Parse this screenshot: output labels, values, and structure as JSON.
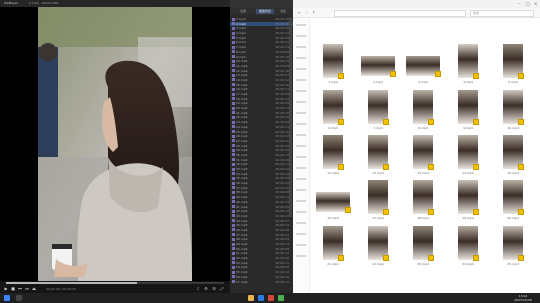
{
  "player": {
    "app_name": "PotPlayer",
    "file_name": "2.mp4 · 1920x1080",
    "time_label": "00:00:18 / 00:00:30"
  },
  "playlist": {
    "header": "播放列表",
    "tabs": [
      "全部",
      "播放列表",
      "书签"
    ],
    "items": [
      {
        "name": "1.mp4",
        "duration": "00:00:30"
      },
      {
        "name": "2.mp4",
        "duration": "00:00:30"
      },
      {
        "name": "3.mp4",
        "duration": "00:00:15"
      },
      {
        "name": "4.mp4",
        "duration": "00:00:12"
      },
      {
        "name": "5.mp4",
        "duration": "00:00:09"
      },
      {
        "name": "6.mp4",
        "duration": "00:00:11"
      },
      {
        "name": "7.mp4",
        "duration": "00:00:14"
      },
      {
        "name": "8.mp4",
        "duration": "00:00:08"
      },
      {
        "name": "9.mp4",
        "duration": "00:00:10"
      },
      {
        "name": "10.mp4",
        "duration": "00:00:13"
      },
      {
        "name": "11.mp4",
        "duration": "00:00:09"
      },
      {
        "name": "12.mp4",
        "duration": "00:00:16"
      },
      {
        "name": "13.mp4",
        "duration": "00:00:07"
      },
      {
        "name": "14.mp4",
        "duration": "00:00:12"
      },
      {
        "name": "15.mp4",
        "duration": "00:00:10"
      },
      {
        "name": "16.mp4",
        "duration": "00:00:11"
      },
      {
        "name": "17.mp4",
        "duration": "00:00:09"
      },
      {
        "name": "18.mp4",
        "duration": "00:00:14"
      },
      {
        "name": "19.mp4",
        "duration": "00:00:08"
      },
      {
        "name": "20.mp4",
        "duration": "00:00:13"
      },
      {
        "name": "21.mp4",
        "duration": "00:00:10"
      },
      {
        "name": "22.mp4",
        "duration": "00:00:12"
      },
      {
        "name": "23.mp4",
        "duration": "00:00:09"
      },
      {
        "name": "24.mp4",
        "duration": "00:00:11"
      },
      {
        "name": "25.mp4",
        "duration": "00:00:15"
      },
      {
        "name": "26.mp4",
        "duration": "00:00:07"
      },
      {
        "name": "27.mp4",
        "duration": "00:00:10"
      },
      {
        "name": "28.mp4",
        "duration": "00:00:12"
      },
      {
        "name": "29.mp4",
        "duration": "00:00:09"
      },
      {
        "name": "30.mp4",
        "duration": "00:00:13"
      },
      {
        "name": "31.mp4",
        "duration": "00:00:08"
      },
      {
        "name": "32.mp4",
        "duration": "00:00:11"
      },
      {
        "name": "33.mp4",
        "duration": "00:00:10"
      },
      {
        "name": "34.mp4",
        "duration": "00:00:14"
      },
      {
        "name": "35.mp4",
        "duration": "00:00:09"
      },
      {
        "name": "36.mp4",
        "duration": "00:00:12"
      },
      {
        "name": "37.mp4",
        "duration": "00:00:10"
      },
      {
        "name": "38.mp4",
        "duration": "00:00:08"
      },
      {
        "name": "39.mp4",
        "duration": "00:00:11"
      },
      {
        "name": "40.mp4",
        "duration": "00:00:13"
      },
      {
        "name": "41.mp4",
        "duration": "00:00:09"
      },
      {
        "name": "42.mp4",
        "duration": "00:00:10"
      },
      {
        "name": "43.mp4",
        "duration": "00:00:12"
      },
      {
        "name": "44.mp4",
        "duration": "00:00:07"
      },
      {
        "name": "45.mp4",
        "duration": "00:00:14"
      },
      {
        "name": "46.mp4",
        "duration": "00:00:10"
      },
      {
        "name": "47.mp4",
        "duration": "00:00:11"
      },
      {
        "name": "48.mp4",
        "duration": "00:00:09"
      },
      {
        "name": "49.mp4",
        "duration": "00:00:13"
      },
      {
        "name": "50.mp4",
        "duration": "00:00:08"
      },
      {
        "name": "51.mp4",
        "duration": "00:00:12"
      },
      {
        "name": "52.mp4",
        "duration": "00:00:10"
      },
      {
        "name": "53.mp4",
        "duration": "00:00:11"
      },
      {
        "name": "54.mp4",
        "duration": "00:00:09"
      },
      {
        "name": "55.mp4",
        "duration": "00:00:14"
      },
      {
        "name": "56.mp4",
        "duration": "00:00:10"
      },
      {
        "name": "57.mp4",
        "duration": "00:00:12"
      }
    ],
    "selected_index": 1
  },
  "explorer": {
    "search_placeholder": "搜索",
    "files": [
      "1.mp4",
      "2.mp4",
      "3.mp4",
      "4.mp4",
      "5.mp4",
      "6.mp4",
      "7.mp4",
      "8.mp4",
      "9.mp4",
      "10.mp4",
      "11.mp4",
      "12.mp4",
      "13.mp4",
      "14.mp4",
      "15.mp4",
      "16.mp4",
      "17.mp4",
      "18.mp4",
      "19.mp4",
      "20.mp4",
      "21.mp4",
      "22.mp4",
      "23.mp4",
      "24.mp4",
      "25.mp4"
    ]
  },
  "taskbar": {
    "time": "13:42",
    "date": "2023/10/28"
  },
  "colors": {
    "accent": "#2f4f7a",
    "badge": "#f2c200",
    "taskbar": "#202020"
  },
  "playback": {
    "progress": 0.6
  }
}
